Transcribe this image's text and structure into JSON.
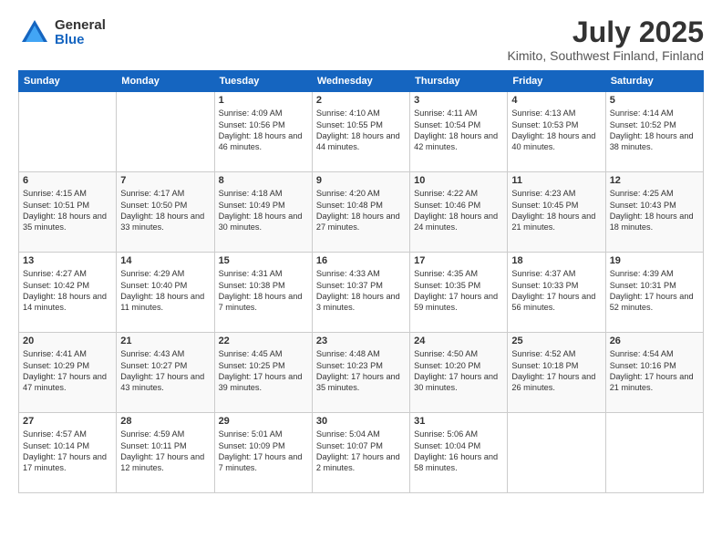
{
  "header": {
    "logo_general": "General",
    "logo_blue": "Blue",
    "title": "July 2025",
    "subtitle": "Kimito, Southwest Finland, Finland"
  },
  "weekdays": [
    "Sunday",
    "Monday",
    "Tuesday",
    "Wednesday",
    "Thursday",
    "Friday",
    "Saturday"
  ],
  "weeks": [
    [
      {
        "day": "",
        "info": ""
      },
      {
        "day": "",
        "info": ""
      },
      {
        "day": "1",
        "info": "Sunrise: 4:09 AM\nSunset: 10:56 PM\nDaylight: 18 hours and 46 minutes."
      },
      {
        "day": "2",
        "info": "Sunrise: 4:10 AM\nSunset: 10:55 PM\nDaylight: 18 hours and 44 minutes."
      },
      {
        "day": "3",
        "info": "Sunrise: 4:11 AM\nSunset: 10:54 PM\nDaylight: 18 hours and 42 minutes."
      },
      {
        "day": "4",
        "info": "Sunrise: 4:13 AM\nSunset: 10:53 PM\nDaylight: 18 hours and 40 minutes."
      },
      {
        "day": "5",
        "info": "Sunrise: 4:14 AM\nSunset: 10:52 PM\nDaylight: 18 hours and 38 minutes."
      }
    ],
    [
      {
        "day": "6",
        "info": "Sunrise: 4:15 AM\nSunset: 10:51 PM\nDaylight: 18 hours and 35 minutes."
      },
      {
        "day": "7",
        "info": "Sunrise: 4:17 AM\nSunset: 10:50 PM\nDaylight: 18 hours and 33 minutes."
      },
      {
        "day": "8",
        "info": "Sunrise: 4:18 AM\nSunset: 10:49 PM\nDaylight: 18 hours and 30 minutes."
      },
      {
        "day": "9",
        "info": "Sunrise: 4:20 AM\nSunset: 10:48 PM\nDaylight: 18 hours and 27 minutes."
      },
      {
        "day": "10",
        "info": "Sunrise: 4:22 AM\nSunset: 10:46 PM\nDaylight: 18 hours and 24 minutes."
      },
      {
        "day": "11",
        "info": "Sunrise: 4:23 AM\nSunset: 10:45 PM\nDaylight: 18 hours and 21 minutes."
      },
      {
        "day": "12",
        "info": "Sunrise: 4:25 AM\nSunset: 10:43 PM\nDaylight: 18 hours and 18 minutes."
      }
    ],
    [
      {
        "day": "13",
        "info": "Sunrise: 4:27 AM\nSunset: 10:42 PM\nDaylight: 18 hours and 14 minutes."
      },
      {
        "day": "14",
        "info": "Sunrise: 4:29 AM\nSunset: 10:40 PM\nDaylight: 18 hours and 11 minutes."
      },
      {
        "day": "15",
        "info": "Sunrise: 4:31 AM\nSunset: 10:38 PM\nDaylight: 18 hours and 7 minutes."
      },
      {
        "day": "16",
        "info": "Sunrise: 4:33 AM\nSunset: 10:37 PM\nDaylight: 18 hours and 3 minutes."
      },
      {
        "day": "17",
        "info": "Sunrise: 4:35 AM\nSunset: 10:35 PM\nDaylight: 17 hours and 59 minutes."
      },
      {
        "day": "18",
        "info": "Sunrise: 4:37 AM\nSunset: 10:33 PM\nDaylight: 17 hours and 56 minutes."
      },
      {
        "day": "19",
        "info": "Sunrise: 4:39 AM\nSunset: 10:31 PM\nDaylight: 17 hours and 52 minutes."
      }
    ],
    [
      {
        "day": "20",
        "info": "Sunrise: 4:41 AM\nSunset: 10:29 PM\nDaylight: 17 hours and 47 minutes."
      },
      {
        "day": "21",
        "info": "Sunrise: 4:43 AM\nSunset: 10:27 PM\nDaylight: 17 hours and 43 minutes."
      },
      {
        "day": "22",
        "info": "Sunrise: 4:45 AM\nSunset: 10:25 PM\nDaylight: 17 hours and 39 minutes."
      },
      {
        "day": "23",
        "info": "Sunrise: 4:48 AM\nSunset: 10:23 PM\nDaylight: 17 hours and 35 minutes."
      },
      {
        "day": "24",
        "info": "Sunrise: 4:50 AM\nSunset: 10:20 PM\nDaylight: 17 hours and 30 minutes."
      },
      {
        "day": "25",
        "info": "Sunrise: 4:52 AM\nSunset: 10:18 PM\nDaylight: 17 hours and 26 minutes."
      },
      {
        "day": "26",
        "info": "Sunrise: 4:54 AM\nSunset: 10:16 PM\nDaylight: 17 hours and 21 minutes."
      }
    ],
    [
      {
        "day": "27",
        "info": "Sunrise: 4:57 AM\nSunset: 10:14 PM\nDaylight: 17 hours and 17 minutes."
      },
      {
        "day": "28",
        "info": "Sunrise: 4:59 AM\nSunset: 10:11 PM\nDaylight: 17 hours and 12 minutes."
      },
      {
        "day": "29",
        "info": "Sunrise: 5:01 AM\nSunset: 10:09 PM\nDaylight: 17 hours and 7 minutes."
      },
      {
        "day": "30",
        "info": "Sunrise: 5:04 AM\nSunset: 10:07 PM\nDaylight: 17 hours and 2 minutes."
      },
      {
        "day": "31",
        "info": "Sunrise: 5:06 AM\nSunset: 10:04 PM\nDaylight: 16 hours and 58 minutes."
      },
      {
        "day": "",
        "info": ""
      },
      {
        "day": "",
        "info": ""
      }
    ]
  ]
}
